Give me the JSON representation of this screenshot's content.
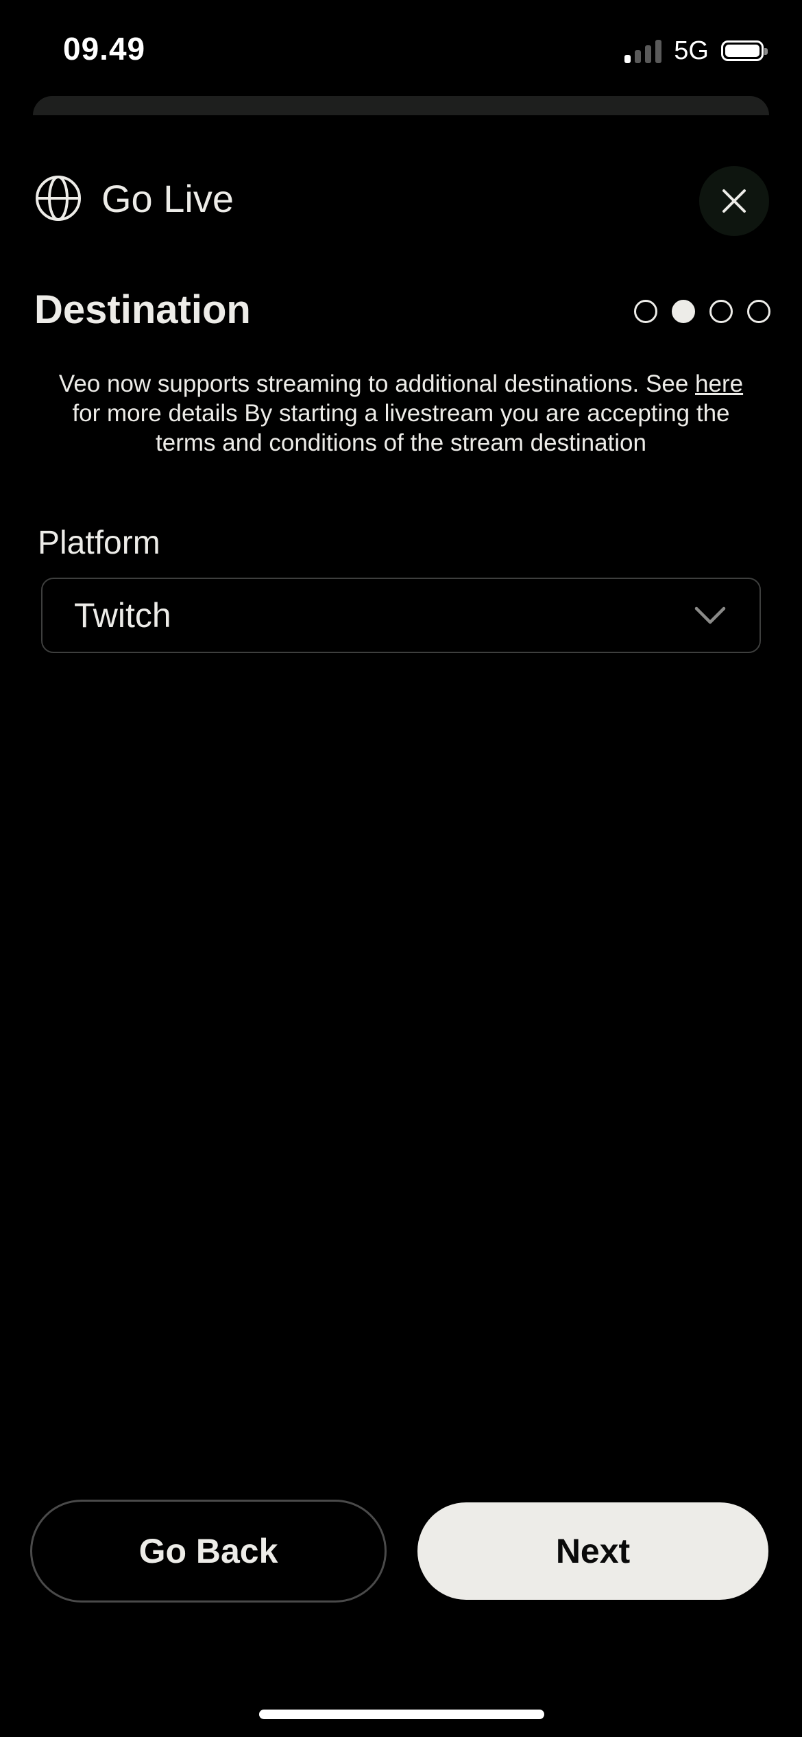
{
  "status_bar": {
    "time": "09.49",
    "network": "5G",
    "signal_bars_on": 1,
    "signal_bars_total": 4
  },
  "header": {
    "title": "Go Live",
    "icon": "globe-icon",
    "close_icon": "close-icon"
  },
  "step": {
    "title": "Destination",
    "total_steps": 4,
    "current_step": 2
  },
  "info": {
    "text_before_link": "Veo now supports streaming to additional destinations. See ",
    "link_text": "here",
    "text_after_link": " for more details By starting a livestream you are accepting the terms and conditions of the stream destination"
  },
  "platform": {
    "label": "Platform",
    "selected": "Twitch",
    "icon": "chevron-down-icon"
  },
  "actions": {
    "back_label": "Go Back",
    "next_label": "Next"
  },
  "colors": {
    "background": "#000000",
    "text": "#EDECE8",
    "primary_button": "#EDECE8",
    "close_button_bg": "#0E150F",
    "border": "#3E3F3E"
  }
}
